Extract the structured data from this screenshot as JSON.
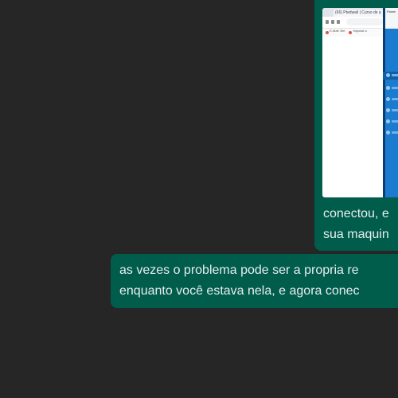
{
  "conversation": {
    "image_message": {
      "thumbnail": {
        "tab_title": "(66) Ptedwali | Curso de a",
        "bookmarks": [
          "E-Mail: Bel",
          "Impossi a"
        ],
        "side_panel_title": "Painel"
      },
      "caption_lines": [
        "conectou, e",
        "sua maquin"
      ]
    },
    "text_message": {
      "lines": [
        "as vezes o problema pode ser a propria re",
        "enquanto você estava nela, e agora conec"
      ]
    }
  },
  "colors": {
    "chat_background": "#262626",
    "outgoing_bubble": "#005c4b",
    "message_text": "#e9edef"
  }
}
